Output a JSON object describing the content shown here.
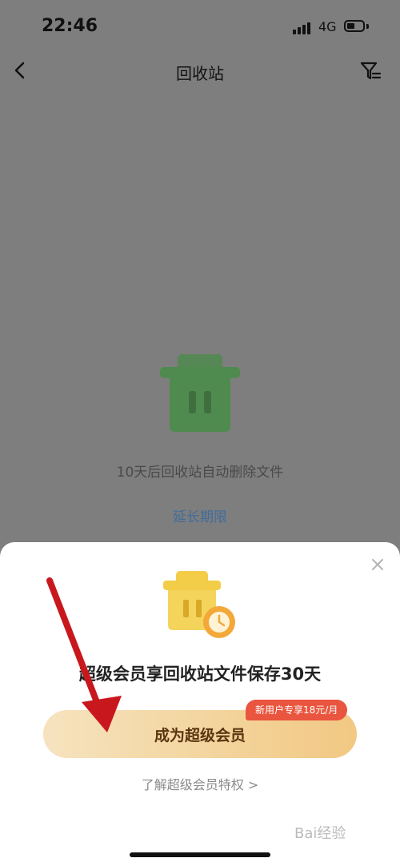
{
  "status_bar": {
    "time": "22:46",
    "network": "4G"
  },
  "header": {
    "title": "回收站"
  },
  "empty_state": {
    "message": "10天后回收站自动删除文件",
    "extend_link": "延长期限"
  },
  "sheet": {
    "title": "超级会员享回收站文件保存30天",
    "primary_button": "成为超级会员",
    "promo_badge": "新用户专享18元/月",
    "learn_more": "了解超级会员特权 >"
  },
  "watermark": {
    "text": "Bai经验"
  },
  "colors": {
    "overlay": "#7e7e7e",
    "trash_green": "#4f8a4f",
    "trash_yellow": "#f3cc48",
    "button_gold": "#f3d39a",
    "promo_red": "#e9553e",
    "link_blue": "#3f6c9c",
    "arrow_red": "#c8181d"
  }
}
